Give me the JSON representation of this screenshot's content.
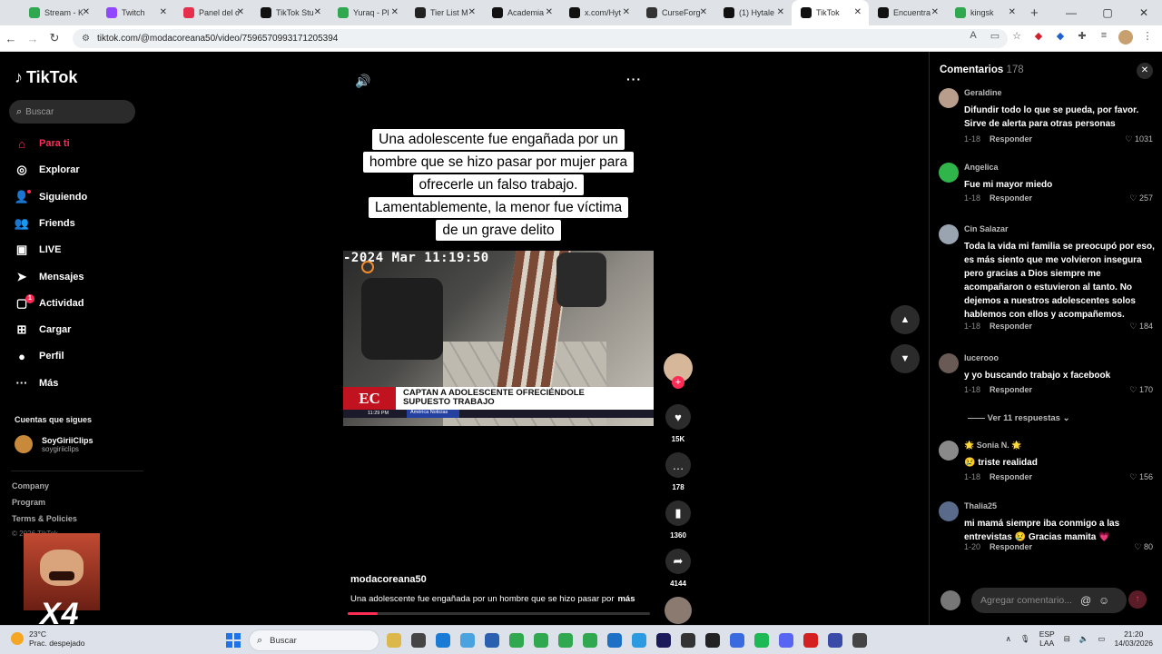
{
  "browser": {
    "tabs": [
      {
        "label": "Stream - K",
        "color": "#2fa84f"
      },
      {
        "label": "Twitch",
        "color": "#9146ff"
      },
      {
        "label": "Panel del c",
        "color": "#e62e4d"
      },
      {
        "label": "TikTok Stu",
        "color": "#111111"
      },
      {
        "label": "Yuraq - Pl",
        "color": "#2fa84f"
      },
      {
        "label": "Tier List M",
        "color": "#222222"
      },
      {
        "label": "Academia",
        "color": "#111111"
      },
      {
        "label": "x.com/Hyt",
        "color": "#111111"
      },
      {
        "label": "CurseForg",
        "color": "#333333"
      },
      {
        "label": "(1) Hytale",
        "color": "#111111"
      },
      {
        "label": "TikTok",
        "color": "#111111",
        "active": true
      },
      {
        "label": "Encuentra",
        "color": "#111111"
      },
      {
        "label": "kingsk",
        "color": "#2fa84f"
      }
    ],
    "url": "tiktok.com/@modacoreana50/video/7596570993171205394"
  },
  "sidebar": {
    "logo": "TikTok",
    "search_placeholder": "Buscar",
    "nav": [
      {
        "label": "Para ti",
        "icon": "home-icon"
      },
      {
        "label": "Explorar",
        "icon": "compass-icon"
      },
      {
        "label": "Siguiendo",
        "icon": "following-icon"
      },
      {
        "label": "Friends",
        "icon": "friends-icon"
      },
      {
        "label": "LIVE",
        "icon": "live-icon"
      },
      {
        "label": "Mensajes",
        "icon": "send-icon"
      },
      {
        "label": "Actividad",
        "icon": "activity-icon",
        "badge": "1"
      },
      {
        "label": "Cargar",
        "icon": "upload-icon"
      },
      {
        "label": "Perfil",
        "icon": "profile-icon"
      },
      {
        "label": "Más",
        "icon": "more-icon"
      }
    ],
    "following_heading": "Cuentas que sigues",
    "following": [
      {
        "name": "SoyGiriiClips",
        "handle": "soygiriiclips"
      }
    ],
    "footer": [
      "Company",
      "Program",
      "Terms & Policies"
    ],
    "copyright": "© 2026 TikTok",
    "overlay_text": "X4"
  },
  "video": {
    "caption_lines": [
      "Una adolescente fue engañada por un",
      "hombre que se hizo pasar por mujer para",
      "ofrecerle un falso trabajo.",
      "Lamentablemente, la menor fue víctima",
      "de un grave delito"
    ],
    "timestamp": "-2024 Mar 11:19:50",
    "news_logo": "EC",
    "news_headline_1": "CAPTAN A ADOLESCENTE OFRECIÉNDOLE",
    "news_headline_2": "SUPUESTO TRABAJO",
    "news_time": "11:29 PM",
    "news_channel": "América Noticias",
    "author": "modacoreana50",
    "description": "Una adolescente fue engañada por un hombre que se hizo pasar por",
    "more_label": "más",
    "progress": 0.1
  },
  "actions": {
    "likes": "15K",
    "comments": "178",
    "saves": "1360",
    "shares": "4144"
  },
  "comments": {
    "title": "Comentarios",
    "count": "178",
    "items": [
      {
        "user": "Geraldine",
        "text": "Difundir todo lo que se pueda, por favor. Sirve de alerta para otras personas",
        "date": "1-18",
        "reply": "Responder",
        "likes": "1031",
        "avatar_color": "#b89c8c"
      },
      {
        "user": "Angelica",
        "text": "Fue mi mayor miedo",
        "date": "1-18",
        "reply": "Responder",
        "likes": "257",
        "avatar_color": "#2fb54a"
      },
      {
        "user": "Cin Salazar",
        "text": "Toda la vida mi familia se preocupó por eso, es más siento que me volvieron insegura pero gracias a Dios siempre me acompañaron o estuvieron al tanto. No dejemos a nuestros adolescentes solos hablemos con ellos y acompañemos.",
        "date": "1-18",
        "reply": "Responder",
        "likes": "184",
        "avatar_color": "#9aa4b0"
      },
      {
        "user": "lucerooo",
        "text": "y yo buscando trabajo x facebook",
        "date": "1-18",
        "reply": "Responder",
        "likes": "170",
        "avatar_color": "#6a5a55"
      },
      {
        "user": "🌟 Sonia N. 🌟",
        "text": "😢 triste realidad",
        "date": "1-18",
        "reply": "Responder",
        "likes": "156",
        "avatar_color": "#8a8a8a"
      },
      {
        "user": "Thalia25",
        "text": "mi mamá siempre iba conmigo a las entrevistas 😢 Gracias mamita 💗",
        "date": "1-20",
        "reply": "Responder",
        "likes": "80",
        "avatar_color": "#5a6a8a"
      }
    ],
    "more_replies": "Ver 11 respuestas",
    "input_placeholder": "Agregar comentario..."
  },
  "taskbar": {
    "temp": "23°C",
    "weather": "Prac. despejado",
    "search": "Buscar",
    "lang1": "ESP",
    "lang2": "LAA",
    "time": "21:20",
    "date": "14/03/2026"
  }
}
